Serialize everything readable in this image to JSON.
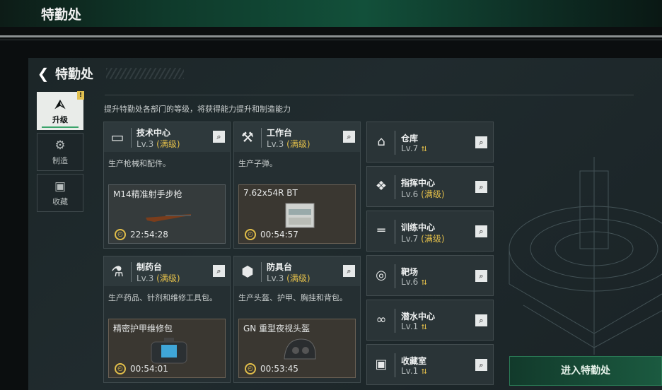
{
  "topbar": {
    "title": "特勤处"
  },
  "header": {
    "title": "特勤处"
  },
  "nav": [
    {
      "label": "升级",
      "icon": "upgrade-icon",
      "active": true,
      "badge": "!"
    },
    {
      "label": "制造",
      "icon": "gear-icon",
      "active": false
    },
    {
      "label": "收藏",
      "icon": "collection-icon",
      "active": false
    }
  ],
  "description": "提升特勤处各部门的等级，将获得能力提升和制造能力",
  "cards": [
    {
      "name": "技术中心",
      "level": "Lv.3",
      "max": "(满级)",
      "desc": "生产枪械和配件。",
      "craft_item": "M14精准射手步枪",
      "time": "22:54:28"
    },
    {
      "name": "工作台",
      "level": "Lv.3",
      "max": "(满级)",
      "desc": "生产子弹。",
      "craft_item": "7.62x54R BT",
      "time": "00:54:57"
    },
    {
      "name": "制药台",
      "level": "Lv.3",
      "max": "(满级)",
      "desc": "生产药品、针剂和维修工具包。",
      "craft_item": "精密护甲维修包",
      "time": "00:54:01"
    },
    {
      "name": "防具台",
      "level": "Lv.3",
      "max": "(满级)",
      "desc": "生产头盔、护甲、胸挂和背包。",
      "craft_item": "GN 重型夜视头盔",
      "time": "00:53:45"
    }
  ],
  "side_facilities": [
    {
      "name": "仓库",
      "level": "Lv.7",
      "max": "",
      "upgradable": true
    },
    {
      "name": "指挥中心",
      "level": "Lv.6",
      "max": "(满级)",
      "upgradable": false
    },
    {
      "name": "训练中心",
      "level": "Lv.7",
      "max": "(满级)",
      "upgradable": false
    },
    {
      "name": "靶场",
      "level": "Lv.6",
      "max": "",
      "upgradable": true
    },
    {
      "name": "潜水中心",
      "level": "Lv.1",
      "max": "",
      "upgradable": true
    },
    {
      "name": "收藏室",
      "level": "Lv.1",
      "max": "",
      "upgradable": true
    }
  ],
  "enter_button": "进入特勤处",
  "colors": {
    "accent": "#e3bf4a",
    "brand_green": "#1b5a40"
  }
}
